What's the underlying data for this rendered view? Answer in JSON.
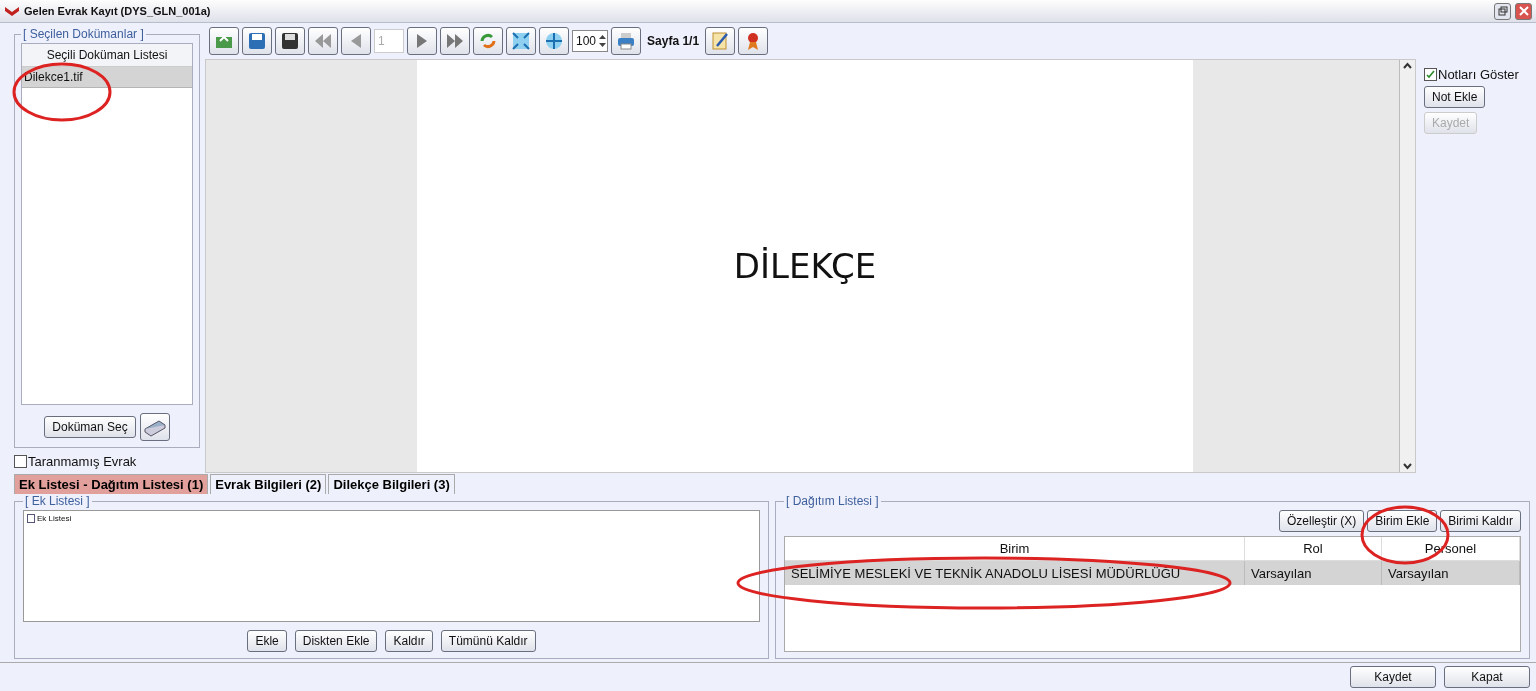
{
  "window": {
    "title": "Gelen Evrak Kayıt (DYS_GLN_001a)"
  },
  "documents_panel": {
    "title": "[ Seçilen Dokümanlar ]",
    "list_header": "Seçili Doküman Listesi",
    "items": [
      {
        "label": "Dilekce1.tif",
        "selected": true
      }
    ],
    "choose_button": "Doküman Seç"
  },
  "unscanned_checkbox": {
    "label": "Taranmamış Evrak",
    "checked": false
  },
  "toolbar": {
    "page_field": "1",
    "zoom": "100",
    "page_label": "Sayfa 1/1"
  },
  "document": {
    "heading": "DİLEKÇE"
  },
  "notes_panel": {
    "show_notes": {
      "label": "Notları Göster",
      "checked": true
    },
    "buttons": [
      {
        "label": "Not Ekle",
        "disabled": false
      },
      {
        "label": "Kaydet",
        "disabled": true
      }
    ]
  },
  "tabs": [
    {
      "label": "Ek Listesi - Dağıtım Listesi (1)",
      "selected": true
    },
    {
      "label": "Evrak Bilgileri (2)",
      "selected": false
    },
    {
      "label": "Dilekçe Bilgileri (3)",
      "selected": false
    }
  ],
  "attachments": {
    "title": "[ Ek Listesi ]",
    "tree_root": "Ek Listesi",
    "buttons": [
      "Ekle",
      "Diskten Ekle",
      "Kaldır",
      "Tümünü Kaldır"
    ]
  },
  "distribution": {
    "title": "[ Dağıtım Listesi ]",
    "buttons": [
      "Özelleştir (X)",
      "Birim Ekle",
      "Birimi Kaldır"
    ],
    "columns": [
      "Birim",
      "Rol",
      "Personel"
    ],
    "rows": [
      {
        "cells": [
          "SELİMİYE MESLEKİ VE TEKNİK ANADOLU LİSESİ MÜDÜRLÜĞÜ",
          "Varsayılan",
          "Varsayılan"
        ],
        "selected": true
      }
    ]
  },
  "footer_buttons": [
    "Kaydet",
    "Kapat"
  ]
}
